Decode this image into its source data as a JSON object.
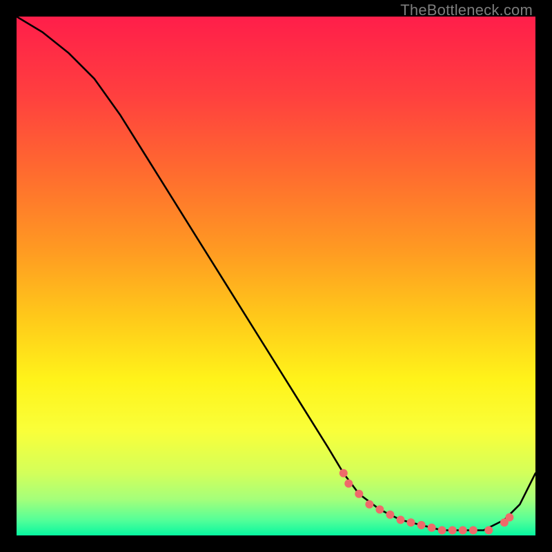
{
  "watermark": "TheBottleneck.com",
  "gradient": {
    "stops": [
      {
        "offset": 0.0,
        "color": "#ff1e4a"
      },
      {
        "offset": 0.15,
        "color": "#ff3f3f"
      },
      {
        "offset": 0.3,
        "color": "#ff6b2f"
      },
      {
        "offset": 0.45,
        "color": "#ff9a22"
      },
      {
        "offset": 0.58,
        "color": "#ffc91a"
      },
      {
        "offset": 0.7,
        "color": "#fff31a"
      },
      {
        "offset": 0.8,
        "color": "#f9ff3a"
      },
      {
        "offset": 0.88,
        "color": "#d3ff5a"
      },
      {
        "offset": 0.93,
        "color": "#a5ff7a"
      },
      {
        "offset": 0.97,
        "color": "#55ff98"
      },
      {
        "offset": 1.0,
        "color": "#07f7a0"
      }
    ]
  },
  "chart_data": {
    "type": "line",
    "title": "",
    "xlabel": "",
    "ylabel": "",
    "xlim": [
      0,
      100
    ],
    "ylim": [
      0,
      100
    ],
    "series": [
      {
        "name": "curve",
        "x": [
          0,
          5,
          10,
          15,
          20,
          25,
          30,
          35,
          40,
          45,
          50,
          55,
          60,
          63,
          66,
          70,
          74,
          78,
          82,
          86,
          90,
          94,
          97,
          98,
          100
        ],
        "y": [
          100,
          97,
          93,
          88,
          81,
          73,
          65,
          57,
          49,
          41,
          33,
          25,
          17,
          12,
          8,
          5,
          3,
          2,
          1,
          1,
          1,
          3,
          6,
          8,
          12
        ]
      }
    ],
    "markers": {
      "name": "highlight-dots",
      "color": "#ef6a6a",
      "x": [
        63,
        64,
        66,
        68,
        70,
        72,
        74,
        76,
        78,
        80,
        82,
        84,
        86,
        88,
        91,
        94,
        95
      ],
      "y": [
        12,
        10,
        8,
        6,
        5,
        4,
        3,
        2.5,
        2,
        1.5,
        1,
        1,
        1,
        1,
        1,
        2.5,
        3.5
      ]
    }
  }
}
